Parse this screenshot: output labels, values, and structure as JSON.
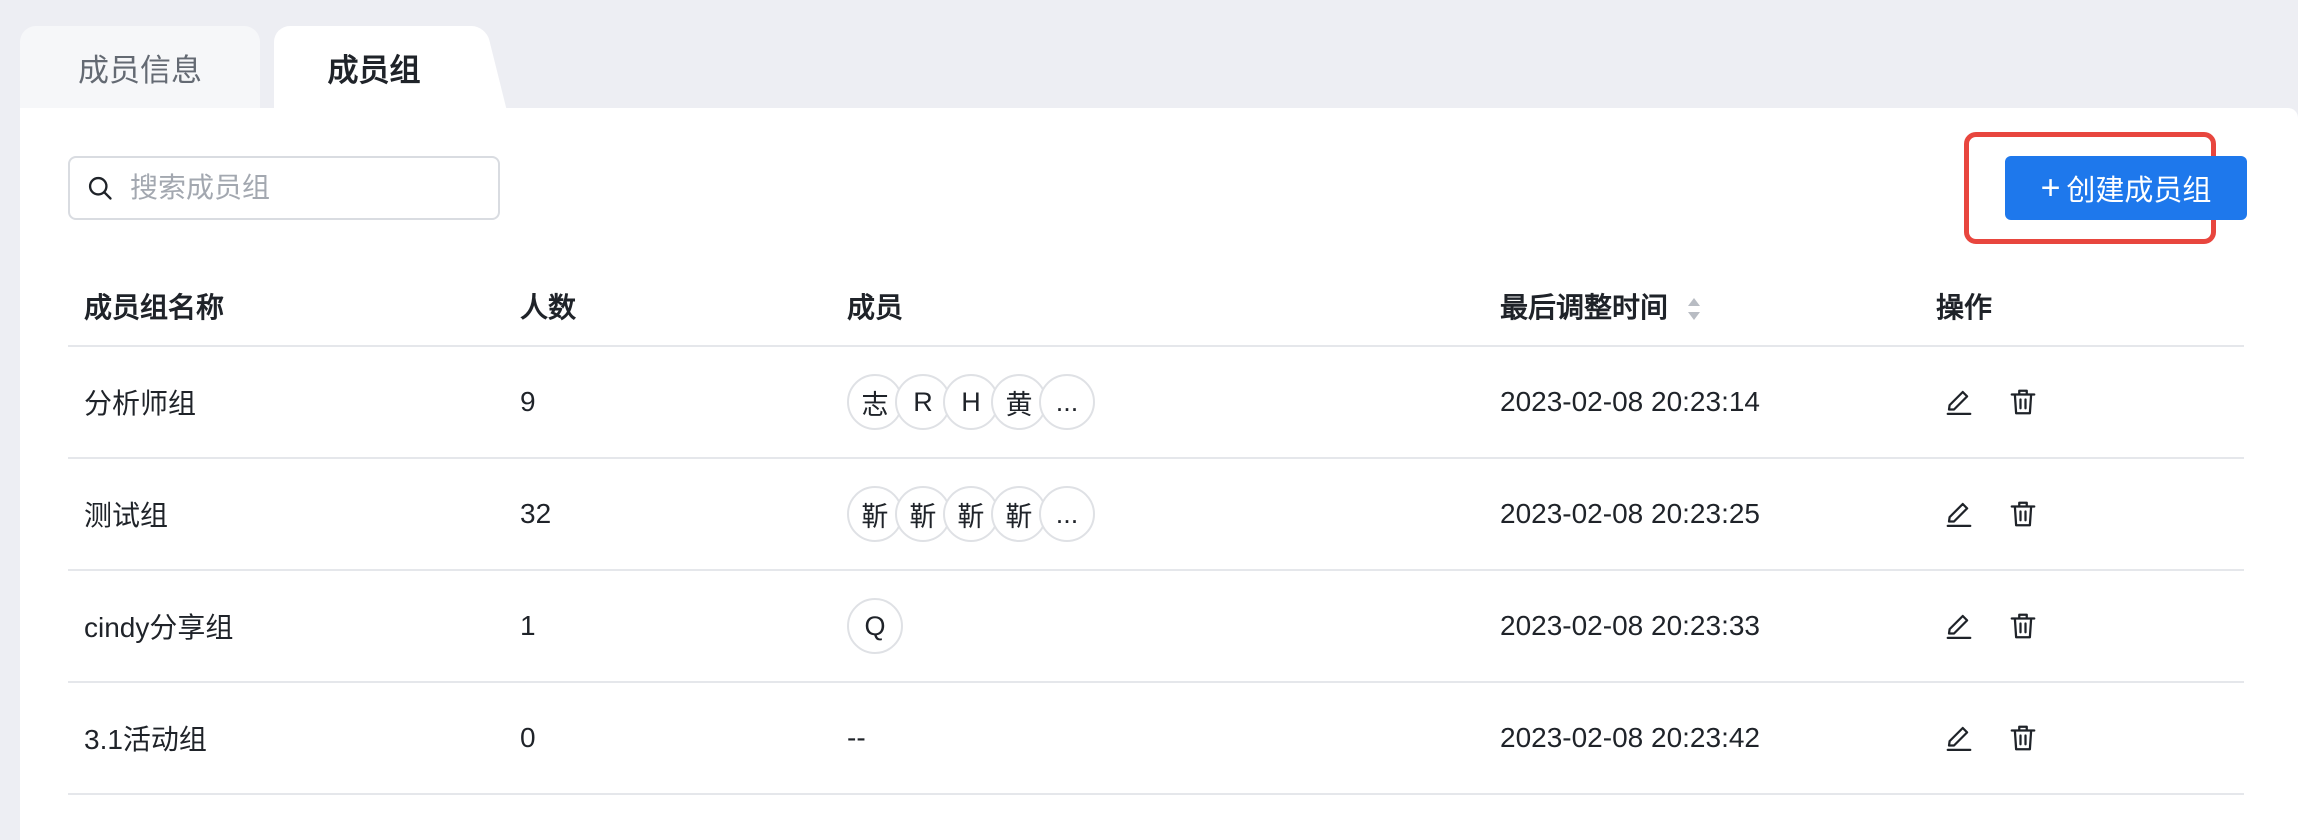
{
  "tabs": [
    {
      "label": "成员信息",
      "active": false
    },
    {
      "label": "成员组",
      "active": true
    }
  ],
  "search": {
    "placeholder": "搜索成员组",
    "icon": "search-icon"
  },
  "toolbar": {
    "create_label": "创建成员组",
    "create_icon": "+"
  },
  "table": {
    "headers": {
      "name": "成员组名称",
      "count": "人数",
      "members": "成员",
      "updated": "最后调整时间",
      "actions": "操作"
    },
    "rows": [
      {
        "name": "分析师组",
        "count": "9",
        "members": [
          "志",
          "R",
          "H",
          "黄",
          "..."
        ],
        "updated": "2023-02-08 20:23:14"
      },
      {
        "name": "测试组",
        "count": "32",
        "members": [
          "靳",
          "靳",
          "靳",
          "靳",
          "..."
        ],
        "updated": "2023-02-08 20:23:25"
      },
      {
        "name": "cindy分享组",
        "count": "1",
        "members": [
          "Q"
        ],
        "updated": "2023-02-08 20:23:33"
      },
      {
        "name": "3.1活动组",
        "count": "0",
        "members_empty": "--",
        "updated": "2023-02-08 20:23:42"
      }
    ]
  },
  "colors": {
    "accent": "#1e78ec",
    "highlight": "#e8463e",
    "background": "#edeef3"
  }
}
